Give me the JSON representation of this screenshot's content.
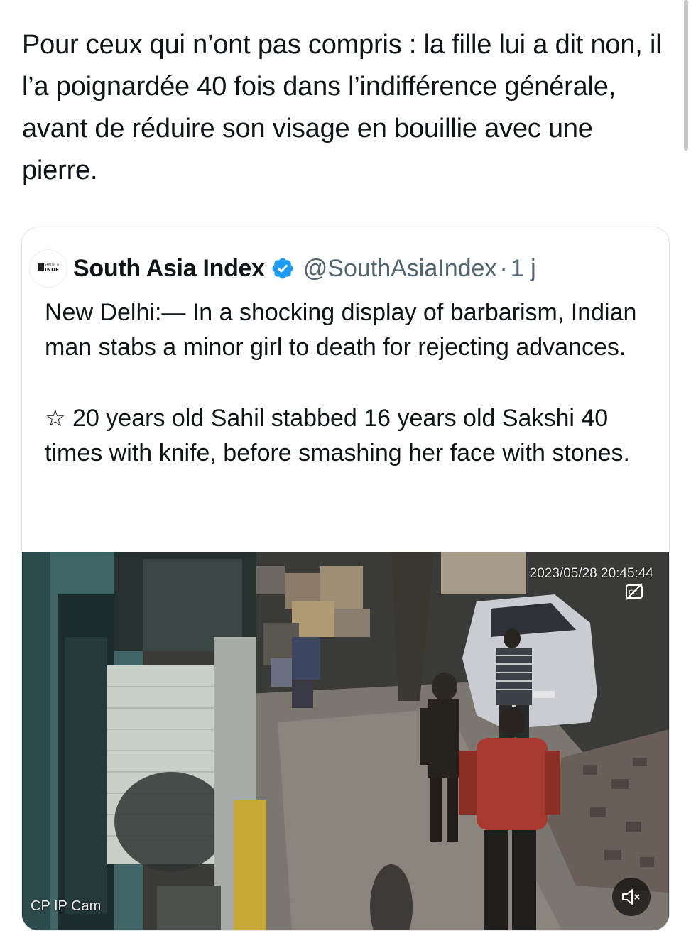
{
  "post": {
    "text": "Pour ceux qui n’ont pas compris : la fille lui a dit non, il l’a poignardée 40 fois dans l’indifférence générale, avant de réduire son visage en bouillie avec une pierre."
  },
  "quoted_post": {
    "avatar_logo": "SOUTH ASIA INDEX",
    "display_name": "South Asia Index",
    "handle": "@SouthAsiaIndex",
    "separator": "·",
    "time": "1 j",
    "body_paragraph_1": "New Delhi:— In a shocking display of barbarism, Indian man stabs a minor girl to death for rejecting advances.",
    "star_glyph": "☆",
    "body_paragraph_2": "20 years old Sahil stabbed 16 years old Sakshi 40 times with knife, before smashing her face with stones.",
    "media": {
      "timestamp": "2023/05/28 20:45:44",
      "camera_label": "CP IP Cam",
      "mute_icon": "speaker-muted-icon",
      "cc_icon": "closed-captions-icon"
    }
  },
  "colors": {
    "text_primary": "#0f1419",
    "text_secondary": "#536471",
    "verified_blue": "#1d9bf0",
    "card_border": "#dfe3e7"
  }
}
